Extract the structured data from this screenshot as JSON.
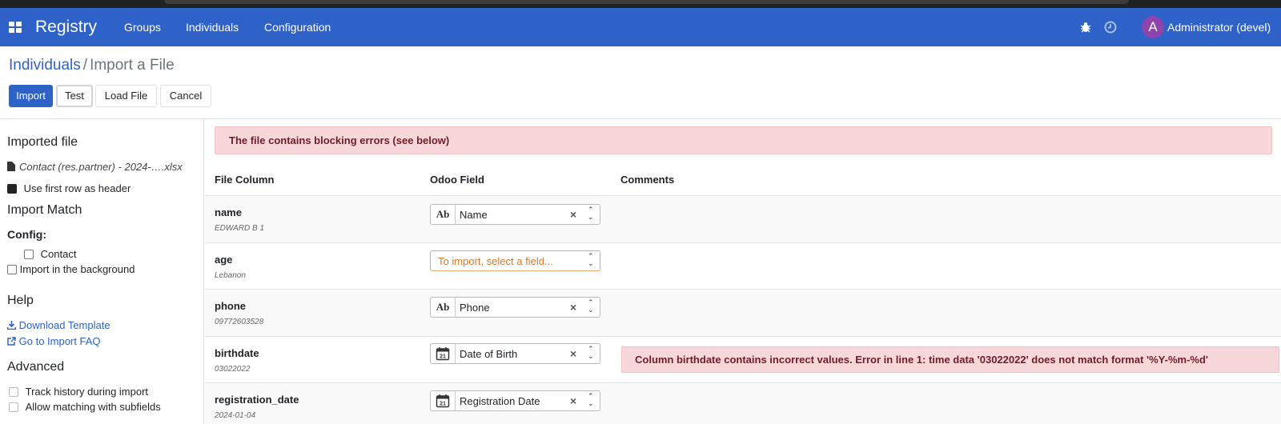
{
  "navbar": {
    "brand": "Registry",
    "menu": [
      "Groups",
      "Individuals",
      "Configuration"
    ],
    "user_initial": "A",
    "user_name": "Administrator (devel)",
    "bg_color": "#2e62c8"
  },
  "breadcrumb": {
    "parent": "Individuals",
    "separator": "/",
    "current": "Import a File"
  },
  "actions": {
    "import": "Import",
    "test": "Test",
    "load_file": "Load File",
    "cancel": "Cancel"
  },
  "sidebar": {
    "imported_file_title": "Imported file",
    "file_name": "Contact (res.partner) - 2024-….xlsx",
    "first_row_header": "Use first row as header",
    "import_match_title": "Import Match",
    "config_label": "Config:",
    "contact_label": "Contact",
    "background_label": "Import in the background",
    "help_title": "Help",
    "download_template": "Download Template",
    "import_faq": "Go to Import FAQ",
    "advanced_title": "Advanced",
    "track_history": "Track history during import",
    "allow_subfields": "Allow matching with subfields"
  },
  "main": {
    "alert": "The file contains blocking errors (see below)",
    "headers": {
      "file_column": "File Column",
      "odoo_field": "Odoo Field",
      "comments": "Comments"
    },
    "rows": [
      {
        "name": "name",
        "sample": "EDWARD B 1",
        "field_type": "Ab",
        "field": "Name",
        "comment": ""
      },
      {
        "name": "age",
        "sample": "Lebanon",
        "field_type": "",
        "field": "To import, select a field...",
        "comment": ""
      },
      {
        "name": "phone",
        "sample": "09772603528",
        "field_type": "Ab",
        "field": "Phone",
        "comment": ""
      },
      {
        "name": "birthdate",
        "sample": "03022022",
        "field_type": "calendar",
        "field": "Date of Birth",
        "comment": "Column birthdate contains incorrect values. Error in line 1: time data '03022022' does not match format '%Y-%m-%d'"
      },
      {
        "name": "registration_date",
        "sample": "2024-01-04",
        "field_type": "calendar",
        "field": "Registration Date",
        "comment": ""
      }
    ]
  }
}
